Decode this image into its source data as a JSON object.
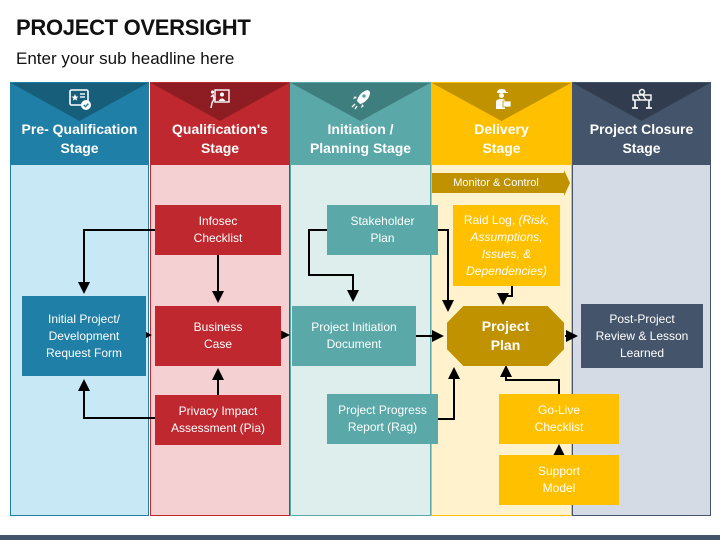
{
  "header": {
    "title": "PROJECT OVERSIGHT",
    "subtitle": "Enter your sub headline here"
  },
  "stages": [
    {
      "label_line1": "Pre- Qualification",
      "label_line2": "Stage",
      "icon": "certificate-icon",
      "color": "#1f7fa6",
      "dark": "#175e7b",
      "body": "#c9e8f5"
    },
    {
      "label_line1": "Qualification's",
      "label_line2": "Stage",
      "icon": "presentation-board-icon",
      "color": "#c0282f",
      "dark": "#8e1d23",
      "body": "#f5d0d3"
    },
    {
      "label_line1": "Initiation /",
      "label_line2": "Planning Stage",
      "icon": "rocket-icon",
      "color": "#5aa8a8",
      "dark": "#3f7e7e",
      "body": "#deeeed"
    },
    {
      "label_line1": "Delivery",
      "label_line2": "Stage",
      "icon": "delivery-worker-icon",
      "color": "#ffc000",
      "dark": "#c09200",
      "body": "#fff2cc"
    },
    {
      "label_line1": "Project Closure",
      "label_line2": "Stage",
      "icon": "barrier-icon",
      "color": "#44546a",
      "dark": "#313d4e",
      "body": "#d5dbe5"
    }
  ],
  "monitor_control": "Monitor & Control",
  "boxes": {
    "initial_request": [
      "Initial Project/",
      "Development",
      "Request Form"
    ],
    "infosec": [
      "Infosec",
      "Checklist"
    ],
    "business_case": [
      "Business",
      "Case"
    ],
    "privacy": [
      "Privacy Impact",
      "Assessment (Pia)"
    ],
    "stakeholder": [
      "Stakeholder",
      "Plan"
    ],
    "pid": [
      "Project Initiation",
      "Document"
    ],
    "progress": [
      "Project Progress",
      "Report (Rag)"
    ],
    "raid_plain": "Raid Log, ",
    "raid_italic": [
      "(Risk,",
      "Assumptions,",
      "Issues, &",
      "Dependencies)"
    ],
    "project_plan": [
      "Project",
      "Plan"
    ],
    "golive": [
      "Go-Live",
      "Checklist"
    ],
    "support": [
      "Support",
      "Model"
    ],
    "post_project": [
      "Post-Project",
      "Review & Lesson",
      "Learned"
    ]
  },
  "colors": {
    "gold": "#c09200",
    "footer": "#44546a"
  }
}
